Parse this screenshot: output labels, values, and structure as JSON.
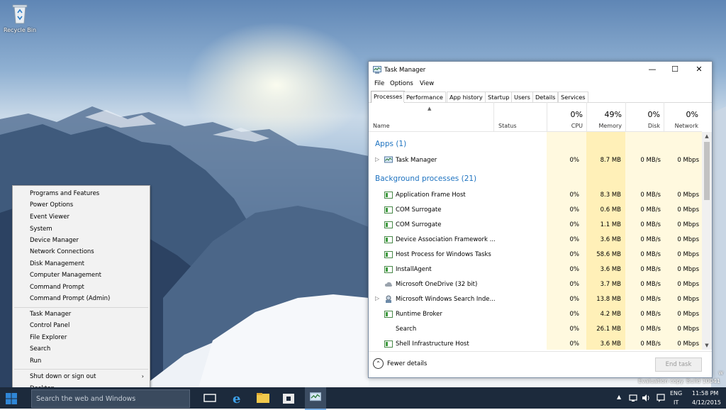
{
  "desktop": {
    "recycle_bin_label": "Recycle Bin",
    "watermark": "Evaluation copy. Build 10041",
    "edge_text": "w"
  },
  "context_menu": {
    "items": [
      "Programs and Features",
      "Power Options",
      "Event Viewer",
      "System",
      "Device Manager",
      "Network Connections",
      "Disk Management",
      "Computer Management",
      "Command Prompt",
      "Command Prompt (Admin)",
      "Task Manager",
      "Control Panel",
      "File Explorer",
      "Search",
      "Run",
      "Shut down or sign out",
      "Desktop"
    ],
    "submenu_arrow": "›"
  },
  "task_manager": {
    "title": "Task Manager",
    "window_buttons": {
      "minimize": "—",
      "maximize": "☐",
      "close": "✕"
    },
    "menu": [
      "File",
      "Options",
      "View"
    ],
    "tabs": [
      "Processes",
      "Performance",
      "App history",
      "Startup",
      "Users",
      "Details",
      "Services"
    ],
    "active_tab": "Processes",
    "columns": {
      "name": "Name",
      "status": "Status",
      "cpu": {
        "label": "CPU",
        "pct": "0%"
      },
      "memory": {
        "label": "Memory",
        "pct": "49%"
      },
      "disk": {
        "label": "Disk",
        "pct": "0%"
      },
      "network": {
        "label": "Network",
        "pct": "0%"
      }
    },
    "apps_group": "Apps (1)",
    "background_group": "Background processes (21)",
    "apps": [
      {
        "name": "Task Manager",
        "cpu": "0%",
        "memory": "8.7 MB",
        "disk": "0 MB/s",
        "network": "0 Mbps"
      }
    ],
    "background": [
      {
        "name": "Application Frame Host",
        "cpu": "0%",
        "memory": "8.3 MB",
        "disk": "0 MB/s",
        "network": "0 Mbps"
      },
      {
        "name": "COM Surrogate",
        "cpu": "0%",
        "memory": "0.6 MB",
        "disk": "0 MB/s",
        "network": "0 Mbps"
      },
      {
        "name": "COM Surrogate",
        "cpu": "0%",
        "memory": "1.1 MB",
        "disk": "0 MB/s",
        "network": "0 Mbps"
      },
      {
        "name": "Device Association Framework ...",
        "cpu": "0%",
        "memory": "3.6 MB",
        "disk": "0 MB/s",
        "network": "0 Mbps"
      },
      {
        "name": "Host Process for Windows Tasks",
        "cpu": "0%",
        "memory": "58.6 MB",
        "disk": "0 MB/s",
        "network": "0 Mbps"
      },
      {
        "name": "InstallAgent",
        "cpu": "0%",
        "memory": "3.6 MB",
        "disk": "0 MB/s",
        "network": "0 Mbps"
      },
      {
        "name": "Microsoft OneDrive (32 bit)",
        "cpu": "0%",
        "memory": "3.7 MB",
        "disk": "0 MB/s",
        "network": "0 Mbps"
      },
      {
        "name": "Microsoft Windows Search Inde...",
        "cpu": "0%",
        "memory": "13.8 MB",
        "disk": "0 MB/s",
        "network": "0 Mbps"
      },
      {
        "name": "Runtime Broker",
        "cpu": "0%",
        "memory": "4.2 MB",
        "disk": "0 MB/s",
        "network": "0 Mbps"
      },
      {
        "name": "Search",
        "cpu": "0%",
        "memory": "26.1 MB",
        "disk": "0 MB/s",
        "network": "0 Mbps"
      },
      {
        "name": "Shell Infrastructure Host",
        "cpu": "0%",
        "memory": "3.6 MB",
        "disk": "0 MB/s",
        "network": "0 Mbps"
      }
    ],
    "fewer_details": "Fewer details",
    "end_task": "End task"
  },
  "taskbar": {
    "search_placeholder": "Search the web and Windows",
    "language": "ENG",
    "region": "IT",
    "time": "11:58 PM",
    "date": "4/12/2015",
    "tray_arrow": "▲"
  },
  "colors": {
    "accent": "#1e73c0",
    "heat": "#fff4c4",
    "taskbar": "#1c2a3c"
  }
}
